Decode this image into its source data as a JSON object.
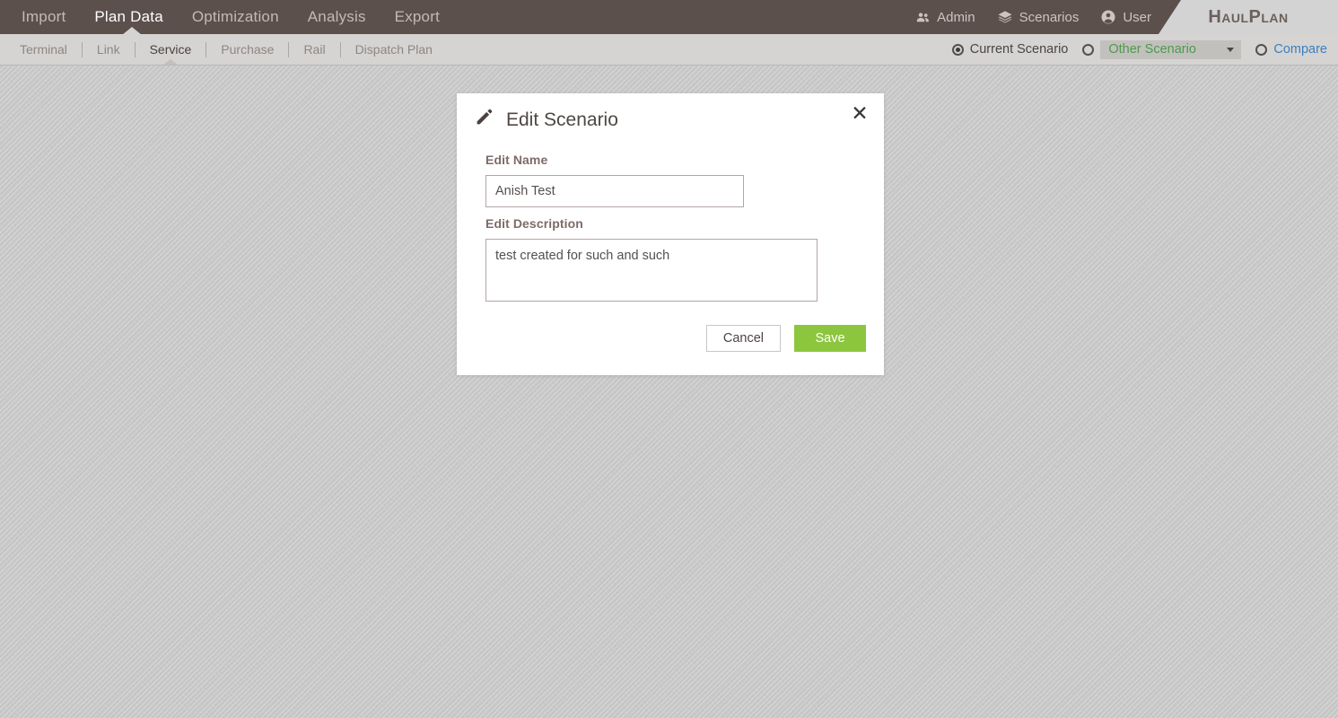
{
  "app": {
    "logo": "HaulPlan"
  },
  "topnav": {
    "items": [
      {
        "label": "Import",
        "active": false
      },
      {
        "label": "Plan Data",
        "active": true
      },
      {
        "label": "Optimization",
        "active": false
      },
      {
        "label": "Analysis",
        "active": false
      },
      {
        "label": "Export",
        "active": false
      }
    ],
    "right_items": [
      {
        "label": "Admin",
        "icon": "people-icon"
      },
      {
        "label": "Scenarios",
        "icon": "layers-icon"
      },
      {
        "label": "User",
        "icon": "user-circle-icon"
      }
    ]
  },
  "subnav": {
    "items": [
      {
        "label": "Terminal",
        "active": false
      },
      {
        "label": "Link",
        "active": false
      },
      {
        "label": "Service",
        "active": true
      },
      {
        "label": "Purchase",
        "active": false
      },
      {
        "label": "Rail",
        "active": false
      },
      {
        "label": "Dispatch Plan",
        "active": false
      }
    ]
  },
  "scenario_selector": {
    "current_scenario_label": "Current Scenario",
    "current_scenario_selected": true,
    "other_scenario_label": "Other Scenario",
    "other_scenario_selected": false,
    "other_scenario_value": "Other Scenario",
    "dropdown_icon": "chevron-down-icon",
    "compare_label": "Compare",
    "compare_selected": false
  },
  "modal": {
    "icon": "pencil-icon",
    "title": "Edit Scenario",
    "close_icon": "close-icon",
    "name_label": "Edit Name",
    "name_value": "Anish Test",
    "name_placeholder": "",
    "description_label": "Edit Description",
    "description_value": "test created for such and such",
    "description_placeholder": "",
    "cancel_label": "Cancel",
    "save_label": "Save"
  },
  "colors": {
    "topbar": "#5b504c",
    "subbar": "#d5d4d2",
    "save_green": "#8cc63e",
    "scenario_green": "#4c9a4c",
    "compare_blue": "#3a7fc1",
    "label_mauve": "#7d6b68"
  }
}
